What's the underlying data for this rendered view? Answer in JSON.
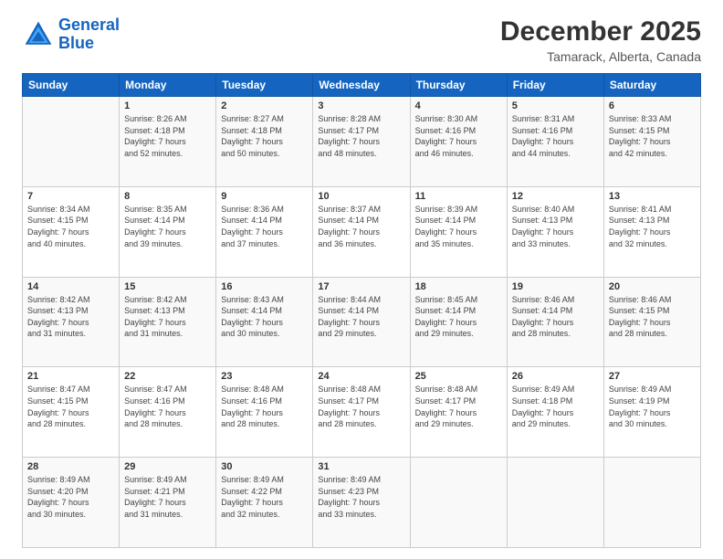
{
  "logo": {
    "line1": "General",
    "line2": "Blue"
  },
  "title": "December 2025",
  "subtitle": "Tamarack, Alberta, Canada",
  "header_days": [
    "Sunday",
    "Monday",
    "Tuesday",
    "Wednesday",
    "Thursday",
    "Friday",
    "Saturday"
  ],
  "weeks": [
    [
      {
        "day": "",
        "detail": ""
      },
      {
        "day": "1",
        "detail": "Sunrise: 8:26 AM\nSunset: 4:18 PM\nDaylight: 7 hours\nand 52 minutes."
      },
      {
        "day": "2",
        "detail": "Sunrise: 8:27 AM\nSunset: 4:18 PM\nDaylight: 7 hours\nand 50 minutes."
      },
      {
        "day": "3",
        "detail": "Sunrise: 8:28 AM\nSunset: 4:17 PM\nDaylight: 7 hours\nand 48 minutes."
      },
      {
        "day": "4",
        "detail": "Sunrise: 8:30 AM\nSunset: 4:16 PM\nDaylight: 7 hours\nand 46 minutes."
      },
      {
        "day": "5",
        "detail": "Sunrise: 8:31 AM\nSunset: 4:16 PM\nDaylight: 7 hours\nand 44 minutes."
      },
      {
        "day": "6",
        "detail": "Sunrise: 8:33 AM\nSunset: 4:15 PM\nDaylight: 7 hours\nand 42 minutes."
      }
    ],
    [
      {
        "day": "7",
        "detail": "Sunrise: 8:34 AM\nSunset: 4:15 PM\nDaylight: 7 hours\nand 40 minutes."
      },
      {
        "day": "8",
        "detail": "Sunrise: 8:35 AM\nSunset: 4:14 PM\nDaylight: 7 hours\nand 39 minutes."
      },
      {
        "day": "9",
        "detail": "Sunrise: 8:36 AM\nSunset: 4:14 PM\nDaylight: 7 hours\nand 37 minutes."
      },
      {
        "day": "10",
        "detail": "Sunrise: 8:37 AM\nSunset: 4:14 PM\nDaylight: 7 hours\nand 36 minutes."
      },
      {
        "day": "11",
        "detail": "Sunrise: 8:39 AM\nSunset: 4:14 PM\nDaylight: 7 hours\nand 35 minutes."
      },
      {
        "day": "12",
        "detail": "Sunrise: 8:40 AM\nSunset: 4:13 PM\nDaylight: 7 hours\nand 33 minutes."
      },
      {
        "day": "13",
        "detail": "Sunrise: 8:41 AM\nSunset: 4:13 PM\nDaylight: 7 hours\nand 32 minutes."
      }
    ],
    [
      {
        "day": "14",
        "detail": "Sunrise: 8:42 AM\nSunset: 4:13 PM\nDaylight: 7 hours\nand 31 minutes."
      },
      {
        "day": "15",
        "detail": "Sunrise: 8:42 AM\nSunset: 4:13 PM\nDaylight: 7 hours\nand 31 minutes."
      },
      {
        "day": "16",
        "detail": "Sunrise: 8:43 AM\nSunset: 4:14 PM\nDaylight: 7 hours\nand 30 minutes."
      },
      {
        "day": "17",
        "detail": "Sunrise: 8:44 AM\nSunset: 4:14 PM\nDaylight: 7 hours\nand 29 minutes."
      },
      {
        "day": "18",
        "detail": "Sunrise: 8:45 AM\nSunset: 4:14 PM\nDaylight: 7 hours\nand 29 minutes."
      },
      {
        "day": "19",
        "detail": "Sunrise: 8:46 AM\nSunset: 4:14 PM\nDaylight: 7 hours\nand 28 minutes."
      },
      {
        "day": "20",
        "detail": "Sunrise: 8:46 AM\nSunset: 4:15 PM\nDaylight: 7 hours\nand 28 minutes."
      }
    ],
    [
      {
        "day": "21",
        "detail": "Sunrise: 8:47 AM\nSunset: 4:15 PM\nDaylight: 7 hours\nand 28 minutes."
      },
      {
        "day": "22",
        "detail": "Sunrise: 8:47 AM\nSunset: 4:16 PM\nDaylight: 7 hours\nand 28 minutes."
      },
      {
        "day": "23",
        "detail": "Sunrise: 8:48 AM\nSunset: 4:16 PM\nDaylight: 7 hours\nand 28 minutes."
      },
      {
        "day": "24",
        "detail": "Sunrise: 8:48 AM\nSunset: 4:17 PM\nDaylight: 7 hours\nand 28 minutes."
      },
      {
        "day": "25",
        "detail": "Sunrise: 8:48 AM\nSunset: 4:17 PM\nDaylight: 7 hours\nand 29 minutes."
      },
      {
        "day": "26",
        "detail": "Sunrise: 8:49 AM\nSunset: 4:18 PM\nDaylight: 7 hours\nand 29 minutes."
      },
      {
        "day": "27",
        "detail": "Sunrise: 8:49 AM\nSunset: 4:19 PM\nDaylight: 7 hours\nand 30 minutes."
      }
    ],
    [
      {
        "day": "28",
        "detail": "Sunrise: 8:49 AM\nSunset: 4:20 PM\nDaylight: 7 hours\nand 30 minutes."
      },
      {
        "day": "29",
        "detail": "Sunrise: 8:49 AM\nSunset: 4:21 PM\nDaylight: 7 hours\nand 31 minutes."
      },
      {
        "day": "30",
        "detail": "Sunrise: 8:49 AM\nSunset: 4:22 PM\nDaylight: 7 hours\nand 32 minutes."
      },
      {
        "day": "31",
        "detail": "Sunrise: 8:49 AM\nSunset: 4:23 PM\nDaylight: 7 hours\nand 33 minutes."
      },
      {
        "day": "",
        "detail": ""
      },
      {
        "day": "",
        "detail": ""
      },
      {
        "day": "",
        "detail": ""
      }
    ]
  ]
}
